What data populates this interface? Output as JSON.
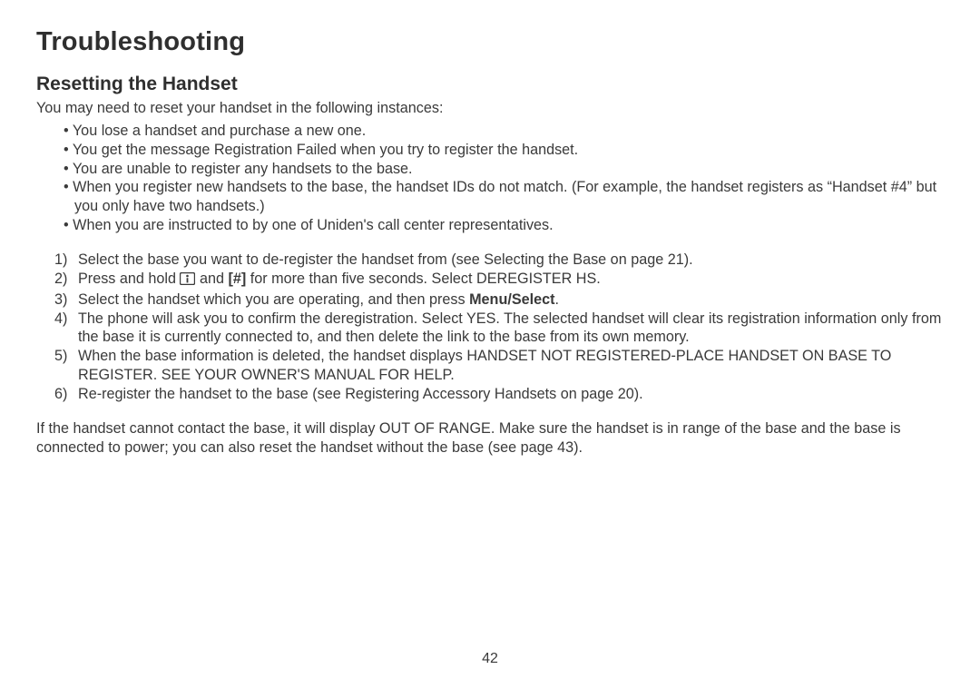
{
  "title": "Troubleshooting",
  "subtitle": "Resetting the Handset",
  "intro": "You may need to reset your handset in the following instances:",
  "when_list": [
    "You lose a handset and purchase a new one.",
    "You get the message Registration Failed when you try to register the handset.",
    "You are unable to register any handsets to the base.",
    "When you register new handsets to the base, the handset IDs do not match. (For example, the handset registers as “Handset #4” but you only have two handsets.)",
    "When you are instructed to by one of Uniden's call center representatives."
  ],
  "steps": {
    "s1": "Select the base you want to de-register the handset from (see Selecting the Base on page 21).",
    "s2_a": "Press and hold ",
    "s2_b": " and ",
    "s2_hash": "[#]",
    "s2_c": " for more than five seconds. Select DEREGISTER HS.",
    "s3_a": "Select the handset which you are operating, and then press ",
    "s3_menu": "Menu/Select",
    "s3_b": ".",
    "s4": "The phone will ask you to confirm the deregistration. Select YES. The selected handset will clear its registration information only from the base it is currently connected to, and then delete the link to the base from its own memory.",
    "s5": "When the base information is deleted, the handset displays HANDSET NOT REGISTERED-PLACE HANDSET ON BASE TO REGISTER. SEE YOUR OWNER'S MANUAL FOR HELP.",
    "s6": "Re-register the handset to the base (see Registering Accessory Handsets on page 20)."
  },
  "closing": "If the handset cannot contact the base, it will display OUT OF RANGE. Make sure the handset is in range of the base and the base is connected to power; you can also reset the handset without the base (see page 43).",
  "page_number": "42"
}
